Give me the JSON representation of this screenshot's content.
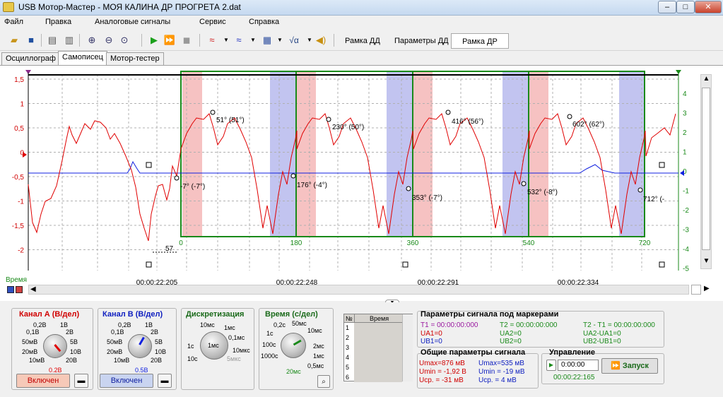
{
  "window": {
    "title": "USB Мотор-Мастер - МОЯ КАЛИНА ДР ПРОГРЕТА 2.dat"
  },
  "menu": [
    "Файл",
    "Правка",
    "Аналоговые сигналы",
    "Сервис",
    "Справка"
  ],
  "toolbar": {
    "tabs": [
      "Рамка ДД",
      "Параметры ДД",
      "Рамка ДР"
    ]
  },
  "tabs": [
    "Осциллограф",
    "Самописец",
    "Мотор-тестер"
  ],
  "scope": {
    "left_axis": [
      "1,5",
      "1",
      "0,5",
      "0",
      "-0,5",
      "-1",
      "-1,5",
      "-2"
    ],
    "right_axis": [
      "4",
      "3",
      "2",
      "1",
      "0",
      "-1",
      "-2",
      "-3",
      "-4",
      "-5"
    ],
    "degree_ticks": [
      "0",
      "180",
      "360",
      "540",
      "720"
    ],
    "markers": [
      "-7° (-7°)",
      "51° (51°)",
      "176° (-4°)",
      "230° (50°)",
      "353° (-7°)",
      "416° (56°)",
      "532° (-8°)",
      "602° (62°)",
      "712° (-"
    ],
    "interval": "57",
    "time_label": "Время",
    "times": [
      "00:00:22:205",
      "00:00:22:248",
      "00:00:22:291",
      "00:00:22:334"
    ],
    "colors": {
      "chA": "#e00000",
      "chB": "#1020e0",
      "frame": "#1a8a1a",
      "red_band": "#f6c2c2",
      "blue_band": "#c2c4f0"
    }
  },
  "chA": {
    "title": "Канал А (В/дел)",
    "dial": [
      "0,2В",
      "1В",
      "0,1В",
      "2В",
      "50мВ",
      "5В",
      "20мВ",
      "10В",
      "10мВ",
      "20В"
    ],
    "value": "0.2В",
    "enable": "Включен"
  },
  "chB": {
    "title": "Канал В (В/дел)",
    "dial": [
      "0,2В",
      "1В",
      "0,1В",
      "2В",
      "50мВ",
      "5В",
      "20мВ",
      "10В",
      "10мВ",
      "20В"
    ],
    "value": "0.5В",
    "enable": "Включен"
  },
  "disc": {
    "title": "Дискретизация",
    "dial": [
      "10мс",
      "1мс",
      "0,1мс",
      "1с",
      "10мкс",
      "10с",
      "5мкс"
    ],
    "value": "1мс"
  },
  "timediv": {
    "title": "Время (с/дел)",
    "dial": [
      "0,2с",
      "50мс",
      "10мс",
      "1с",
      "2мс",
      "100с",
      "1мс",
      "1000с",
      "0,5мс"
    ],
    "value": "20мс"
  },
  "table": {
    "col1": "№",
    "col2": "Время",
    "rows": [
      "1",
      "2",
      "3",
      "4",
      "5",
      "6"
    ]
  },
  "marker_params": {
    "title": "Параметры сигнала под маркерами",
    "t1": "T1 = 00:00:00:000",
    "t2": "T2 = 00:00:00:000",
    "t21": "T2 - T1 = 00:00:00:000",
    "ua1": "UA1=0",
    "ua2": "UA2=0",
    "uad": "UA2-UA1=0",
    "ub1": "UB1=0",
    "ub2": "UB2=0",
    "ubd": "UB2-UB1=0"
  },
  "general": {
    "title": "Общие параметры сигнала",
    "umax_a": "Umax=876 мВ",
    "umin_a": "Umin = -1,92 В",
    "ucp_a": "Uср. = -31 мВ",
    "umax_b": "Umax=535 мВ",
    "umin_b": "Umin = -19 мВ",
    "ucp_b": "Uср. =   4 мВ"
  },
  "control": {
    "title": "Управление",
    "time_value": "0:00:00",
    "start": "Запуск",
    "clock": "00:00:22:165"
  }
}
